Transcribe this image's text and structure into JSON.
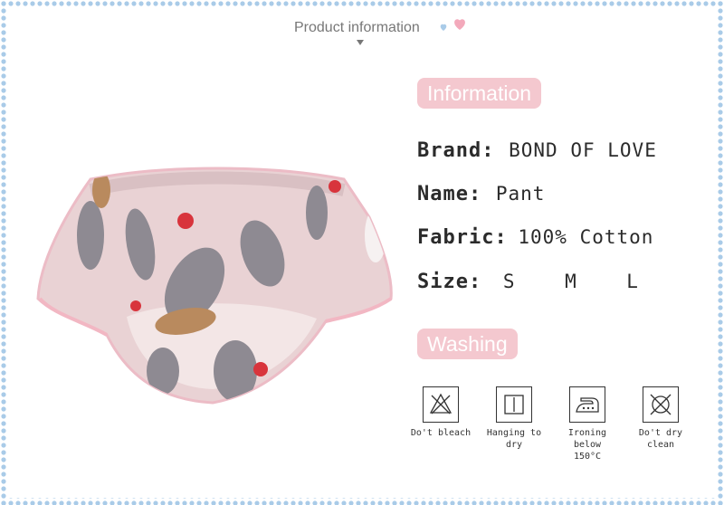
{
  "header": {
    "title": "Product information"
  },
  "info_section": {
    "label": "Information"
  },
  "details": [
    {
      "label": "Brand:",
      "value": "BOND OF LOVE"
    },
    {
      "label": "Name:",
      "value": "Pant"
    },
    {
      "label": "Fabric:",
      "value": "100% Cotton"
    },
    {
      "label": "Size:",
      "value": "S    M    L"
    }
  ],
  "washing_section": {
    "label": "Washing"
  },
  "care": [
    {
      "icon": "no-bleach-icon",
      "caption": "Do't bleach"
    },
    {
      "icon": "hang-dry-icon",
      "caption": "Hanging to dry"
    },
    {
      "icon": "iron-icon",
      "caption": "Ironing below 150°C"
    },
    {
      "icon": "no-dry-clean-icon",
      "caption": "Do't dry clean"
    }
  ],
  "colors": {
    "border_dots": "#a9cbe8",
    "pill": "#f4c8cf",
    "heart": "#f3a9bb",
    "fabric": "#e9d2d4"
  }
}
